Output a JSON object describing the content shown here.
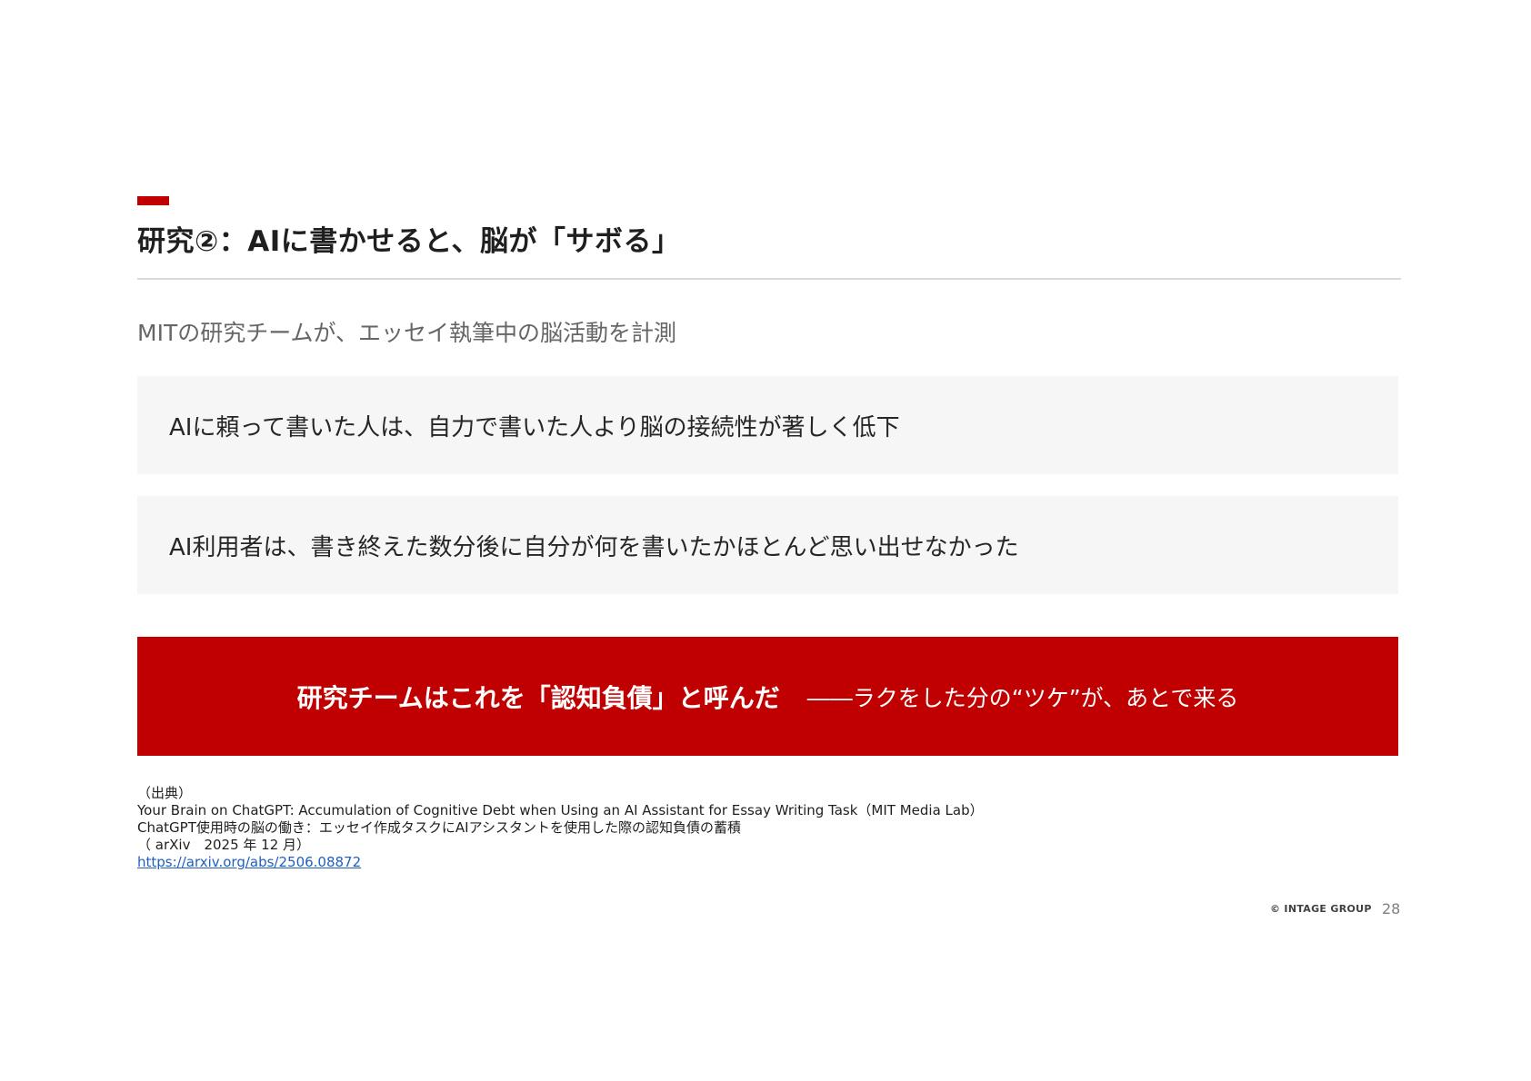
{
  "slide": {
    "title": "研究②：AIに書かせると、脳が「サボる」",
    "subtitle": "MITの研究チームが、エッセイ執筆中の脳活動を計測",
    "findings": [
      "AIに頼って書いた人は、自力で書いた人より脳の接続性が著しく低下",
      "AI利用者は、書き終えた数分後に自分が何を書いたかほとんど思い出せなかった"
    ],
    "conclusion": {
      "main": "研究チームはこれを「認知負債」と呼んだ",
      "sub": "――ラクをした分の“ツケ”が、あとで来る"
    },
    "source": {
      "label": "（出典）",
      "line1": "Your Brain on ChatGPT: Accumulation of Cognitive Debt when Using an AI Assistant for Essay Writing Task（MIT Media Lab）",
      "line2": "ChatGPT使用時の脳の働き：エッセイ作成タスクにAIアシスタントを使用した際の認知負債の蓄積",
      "line3": "（ arXiv　2025 年 12 月）",
      "url": "https://arxiv.org/abs/2506.08872"
    },
    "footer": {
      "brand": "© INTAGE GROUP",
      "page_number": "28"
    }
  },
  "colors": {
    "accent": "#c00000",
    "finding_background": "#f6f6f6",
    "link": "#1f5fbf"
  }
}
